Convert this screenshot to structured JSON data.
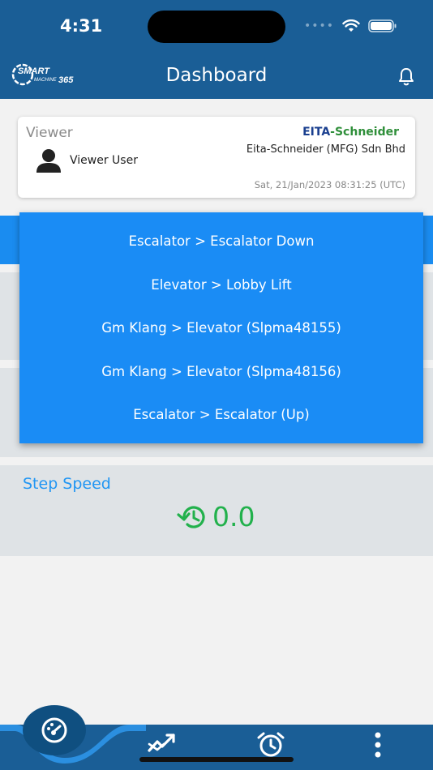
{
  "status_bar": {
    "time": "4:31",
    "dots": "••••"
  },
  "header": {
    "logo_text": "SMART MACHINE 365",
    "title": "Dashboard"
  },
  "user_card": {
    "role": "Viewer",
    "user_name": "Viewer User",
    "brand_eita": "EITA",
    "brand_schneider": "-Schneider",
    "company": "Eita-Schneider (MFG) Sdn Bhd",
    "datetime": "Sat, 21/Jan/2023 08:31:25 (UTC)"
  },
  "dropdown": {
    "items": [
      "Escalator > Escalator Down",
      "Elevator > Lobby Lift",
      "Gm Klang > Elevator (Slpma48155)",
      "Gm Klang > Elevator (Slpma48156)",
      "Escalator > Escalator (Up)"
    ]
  },
  "step_speed": {
    "label": "Step Speed",
    "value": "0.0",
    "value_color": "#22b14c"
  },
  "colors": {
    "header": "#1a5e96",
    "dropdown": "#1a8cf5",
    "accent": "#2196f3"
  },
  "icons": [
    "wifi-icon",
    "battery-icon",
    "bell-icon",
    "avatar-icon",
    "history-icon",
    "dashboard-icon",
    "trend-icon",
    "alarm-icon",
    "more-vertical-icon"
  ]
}
